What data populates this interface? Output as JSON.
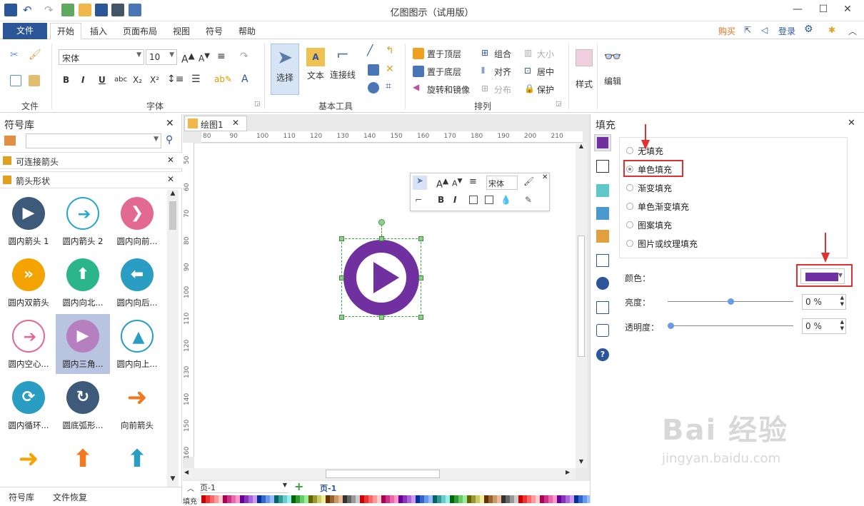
{
  "window": {
    "title": "亿图图示（试用版）",
    "minimize": "—",
    "maximize": "☐",
    "close": "✕"
  },
  "menu": {
    "file": "文件",
    "tabs": [
      "开始",
      "插入",
      "页面布局",
      "视图",
      "符号",
      "帮助"
    ],
    "active": "开始",
    "right": {
      "buy": "购买",
      "login": "登录"
    }
  },
  "ribbon": {
    "file_group": "文件",
    "font_group": "字体",
    "font_name": "宋体",
    "font_size": "10",
    "basic_tools_group": "基本工具",
    "select_label": "选择",
    "text_label": "文本",
    "connector_label": "连接线",
    "arrange_group": "排列",
    "bring_front": "置于顶层",
    "send_back": "置于底层",
    "rotate_mirror": "旋转和镜像",
    "group": "组合",
    "align": "对齐",
    "distribute": "分布",
    "size": "大小",
    "center": "居中",
    "protect": "保护",
    "style_label": "样式",
    "edit_label": "编辑"
  },
  "library": {
    "title": "符号库",
    "search_placeholder": "",
    "categories": [
      "可连接箭头",
      "箭头形状"
    ],
    "symbols": [
      {
        "label": "圆内箭头 1",
        "color": "#3d5a7a",
        "glyph": "▶",
        "style": "solid"
      },
      {
        "label": "圆内箭头 2",
        "color": "#2aa6c9",
        "glyph": "➔",
        "style": "ring"
      },
      {
        "label": "圆内向前...",
        "color": "#e26a92",
        "glyph": "❯",
        "style": "solid"
      },
      {
        "label": "圆内双箭头",
        "color": "#f5a300",
        "glyph": "»",
        "style": "solid"
      },
      {
        "label": "圆内向北...",
        "color": "#2bb58a",
        "glyph": "⬆",
        "style": "solid"
      },
      {
        "label": "圆内向后...",
        "color": "#2a9dc2",
        "glyph": "⬅",
        "style": "solid"
      },
      {
        "label": "圆内空心...",
        "color": "#e26a92",
        "glyph": "➔",
        "style": "ring"
      },
      {
        "label": "圆内三角...",
        "color": "#b57fc0",
        "glyph": "▶",
        "style": "solid"
      },
      {
        "label": "圆内向上...",
        "color": "#2a9dc2",
        "glyph": "▲",
        "style": "ring"
      },
      {
        "label": "圆内循环...",
        "color": "#2a9dc2",
        "glyph": "⟳",
        "style": "solid"
      },
      {
        "label": "圆底弧形...",
        "color": "#3d5a7a",
        "glyph": "↻",
        "style": "solid"
      },
      {
        "label": "向前箭头",
        "color": "#f07a22",
        "glyph": "➜",
        "style": "plain"
      },
      {
        "label": "",
        "color": "#f5a300",
        "glyph": "➜",
        "style": "plain"
      },
      {
        "label": "",
        "color": "#f07a22",
        "glyph": "⬆",
        "style": "plain"
      },
      {
        "label": "",
        "color": "#2a9dc2",
        "glyph": "⬆",
        "style": "plain"
      }
    ],
    "bottom_tabs": [
      "符号库",
      "文件恢复"
    ]
  },
  "document": {
    "tab_name": "绘图1",
    "ruler_h": [
      "80",
      "90",
      "100",
      "110",
      "120",
      "130",
      "140",
      "150",
      "160",
      "170",
      "180",
      "190",
      "200",
      "210"
    ],
    "ruler_v": [
      "50",
      "60",
      "70",
      "80",
      "90",
      "100",
      "110",
      "120",
      "130",
      "140",
      "150",
      "160"
    ],
    "page_selector": "页-1",
    "page_tab": "页-1",
    "fill_label": "填充",
    "shape_color": "#7030a0",
    "float_font": "宋体"
  },
  "fill_panel": {
    "title": "填充",
    "options": [
      "无填充",
      "单色填充",
      "渐变填充",
      "单色渐变填充",
      "图案填充",
      "图片或纹理填充"
    ],
    "selected": "单色填充",
    "color_label": "颜色：",
    "color_value": "#7030a0",
    "brightness_label": "亮度：",
    "brightness_value": "0 %",
    "transparency_label": "透明度：",
    "transparency_value": "0 %",
    "brightness_level": 0.5,
    "transparency_level": 0
  },
  "watermark": {
    "line1": "Bai 经验",
    "line2": "jingyan.baidu.com"
  }
}
